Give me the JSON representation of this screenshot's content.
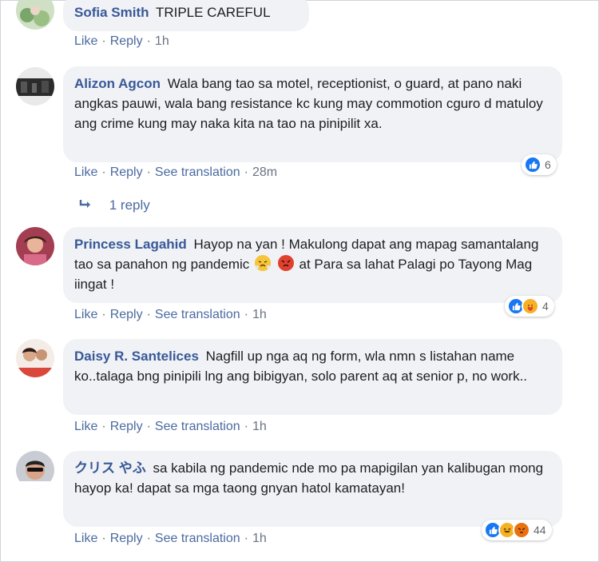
{
  "comments": [
    {
      "author": "Sofia Smith",
      "text": "TRIPLE CAREFUL",
      "actions": {
        "like": "Like",
        "reply": "Reply",
        "time": "1h"
      }
    },
    {
      "author": "Alizon Agcon",
      "text": "Wala bang tao sa motel, receptionist, o guard, at pano naki angkas pauwi, wala bang resistance kc kung may commotion cguro d matuloy ang crime kung may naka kita na tao na pinipilit xa.",
      "actions": {
        "like": "Like",
        "reply": "Reply",
        "translate": "See translation",
        "time": "28m"
      },
      "reactions": {
        "icons": [
          "like-icon"
        ],
        "count": "6"
      },
      "replies_label": "1 reply"
    },
    {
      "author": "Princess Lagahid",
      "text_before": "Hayop na yan ! Makulong dapat ang mapag samantalang tao sa panahon ng pandemic",
      "text_after": "at Para sa lahat Palagi po Tayong Mag iingat !",
      "inline_emojis": [
        "steam-face-emoji",
        "angry-face-emoji"
      ],
      "actions": {
        "like": "Like",
        "reply": "Reply",
        "translate": "See translation",
        "time": "1h"
      },
      "reactions": {
        "icons": [
          "like-icon",
          "care-icon"
        ],
        "count": "4"
      }
    },
    {
      "author": "Daisy R. Santelices",
      "text": "Nagfill up nga aq ng form, wla nmn s listahan name ko..talaga bng pinipili lng ang bibigyan, solo parent aq at senior p, no work..",
      "actions": {
        "like": "Like",
        "reply": "Reply",
        "translate": "See translation",
        "time": "1h"
      }
    },
    {
      "author": "クリス やふ",
      "text": "sa kabila ng pandemic nde mo pa mapigilan yan kalibugan mong hayop ka! dapat sa mga taong gnyan hatol kamatayan!",
      "actions": {
        "like": "Like",
        "reply": "Reply",
        "translate": "See translation",
        "time": "1h"
      },
      "reactions": {
        "icons": [
          "like-icon",
          "haha-icon",
          "angry-icon"
        ],
        "count": "44"
      }
    }
  ],
  "separator": "·",
  "colors": {
    "author": "#385898",
    "link": "#4b6aa0",
    "bubble": "#f0f2f5",
    "like": "#1877f2"
  }
}
